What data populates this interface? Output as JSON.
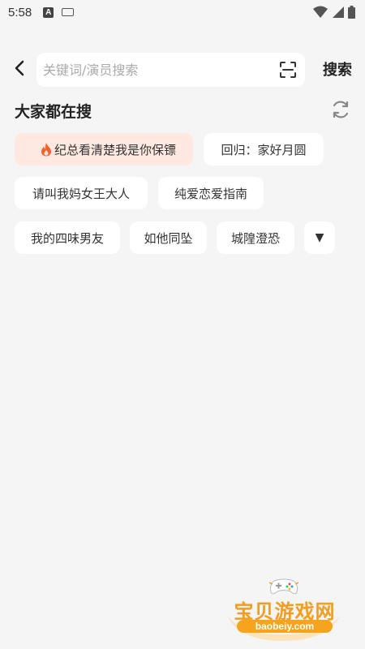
{
  "status_bar": {
    "time": "5:58",
    "notification_icon_letter": "A",
    "icons": [
      "keyboard-icon",
      "wifi-icon",
      "signal-icon",
      "battery-icon"
    ]
  },
  "header": {
    "back_icon": "chevron-left-icon",
    "search_placeholder": "关键词/演员搜索",
    "search_value": "",
    "scan_icon": "scan-icon",
    "search_button": "搜索"
  },
  "hot_section": {
    "title": "大家都在搜",
    "refresh_icon": "refresh-icon",
    "tags": [
      {
        "label": "纪总看清楚我是你保镖",
        "hot": true
      },
      {
        "label": "回归：家好月圆",
        "hot": false
      },
      {
        "label": "请叫我妈女王大人",
        "hot": false
      },
      {
        "label": "纯爱恋爱指南",
        "hot": false
      },
      {
        "label": "我的四味男友",
        "hot": false
      },
      {
        "label": "如他同坠",
        "hot": false
      },
      {
        "label": "城隍澄恐",
        "hot": false
      }
    ],
    "more_symbol": "▼"
  },
  "watermark": {
    "title": "宝贝游戏网",
    "url": "baobeiy.com"
  },
  "colors": {
    "background": "#f5f5f5",
    "hot_tag_bg": "#fde9e1",
    "fire": "#f4622b",
    "watermark": "#f39c1e"
  }
}
